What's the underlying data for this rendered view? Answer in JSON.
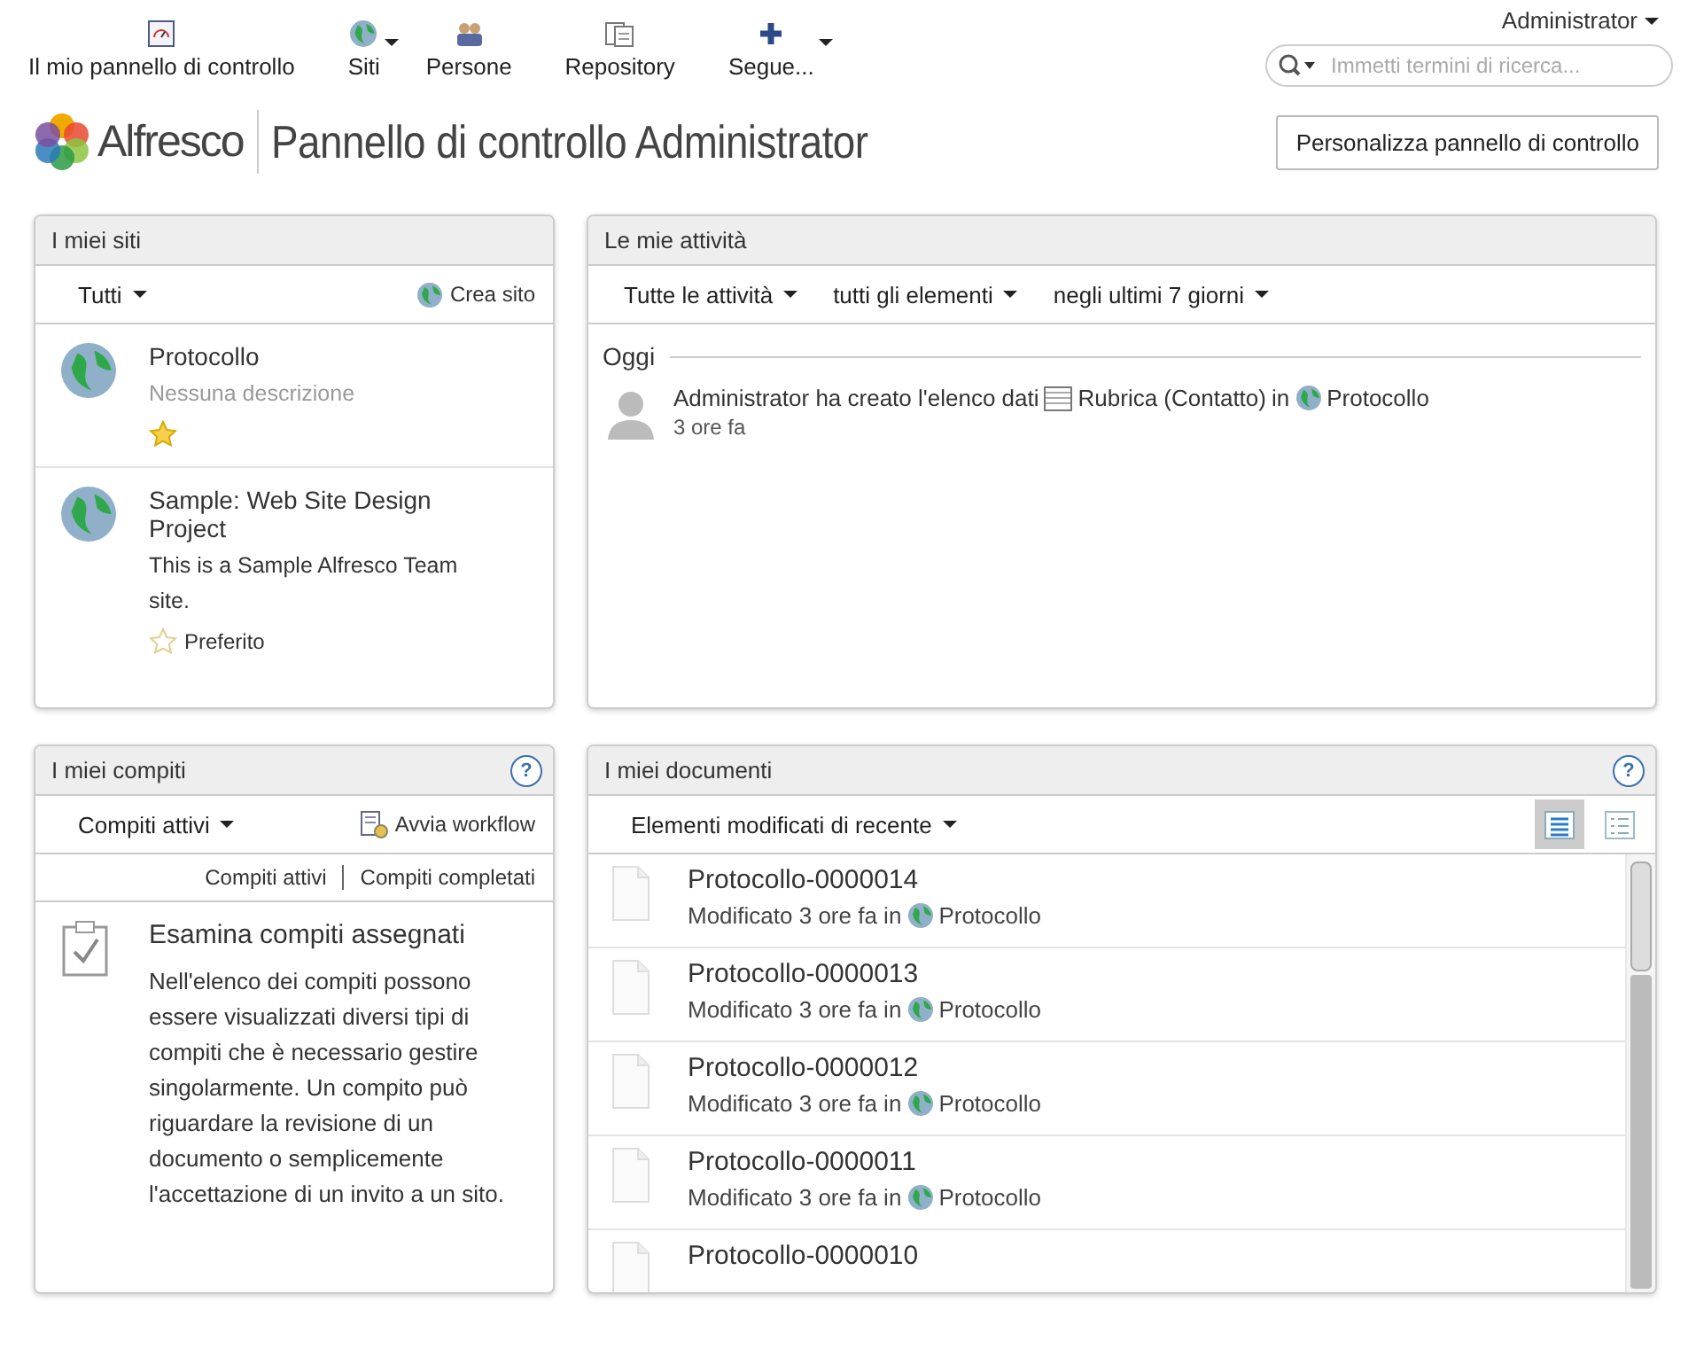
{
  "nav": {
    "items": [
      {
        "label": "Il mio pannello di controllo",
        "dropdown": false
      },
      {
        "label": "Siti",
        "dropdown": true
      },
      {
        "label": "Persone",
        "dropdown": false
      },
      {
        "label": "Repository",
        "dropdown": false
      },
      {
        "label": "Segue...",
        "dropdown": true
      }
    ],
    "user": "Administrator",
    "search_placeholder": "Immetti termini di ricerca..."
  },
  "header": {
    "logo": "Alfresco",
    "title": "Pannello di controllo Administrator",
    "customize_button": "Personalizza pannello di controllo"
  },
  "my_sites": {
    "title": "I miei siti",
    "filter": "Tutti",
    "create": "Crea sito",
    "sites": [
      {
        "name": "Protocollo",
        "description": "Nessuna descrizione",
        "has_description": false,
        "favorite": true
      },
      {
        "name": "Sample: Web Site Design Project",
        "description": "This is a Sample Alfresco Team site.",
        "has_description": true,
        "favorite": false,
        "favorite_label": "Preferito"
      }
    ]
  },
  "my_activities": {
    "title": "Le mie attività",
    "filters": [
      "Tutte le attività",
      "tutti gli elementi",
      "negli ultimi 7 giorni"
    ],
    "day": "Oggi",
    "items": [
      {
        "text": "Administrator ha creato l'elenco dati",
        "object": "Rubrica (Contatto)",
        "in": "in",
        "site": "Protocollo",
        "time": "3 ore fa"
      }
    ]
  },
  "my_tasks": {
    "title": "I miei compiti",
    "help": "?",
    "filter": "Compiti attivi",
    "start": "Avvia workflow",
    "links": [
      "Compiti attivi",
      "Compiti completati"
    ],
    "empty_title": "Esamina compiti assegnati",
    "empty_text": "Nell'elenco dei compiti possono essere visualizzati diversi tipi di compiti che è necessario gestire singolarmente. Un compito può riguardare la revisione di un documento o semplicemente l'accettazione di un invito a un sito."
  },
  "my_documents": {
    "title": "I miei documenti",
    "help": "?",
    "filter": "Elementi modificati di recente",
    "views": [
      {
        "kind": "detailed",
        "selected": true
      },
      {
        "kind": "simple",
        "selected": false
      }
    ],
    "documents": [
      {
        "name": "Protocollo-0000014",
        "meta": "Modificato 3 ore fa in",
        "site": "Protocollo"
      },
      {
        "name": "Protocollo-0000013",
        "meta": "Modificato 3 ore fa in",
        "site": "Protocollo"
      },
      {
        "name": "Protocollo-0000012",
        "meta": "Modificato 3 ore fa in",
        "site": "Protocollo"
      },
      {
        "name": "Protocollo-0000011",
        "meta": "Modificato 3 ore fa in",
        "site": "Protocollo"
      },
      {
        "name": "Protocollo-0000010"
      }
    ]
  }
}
